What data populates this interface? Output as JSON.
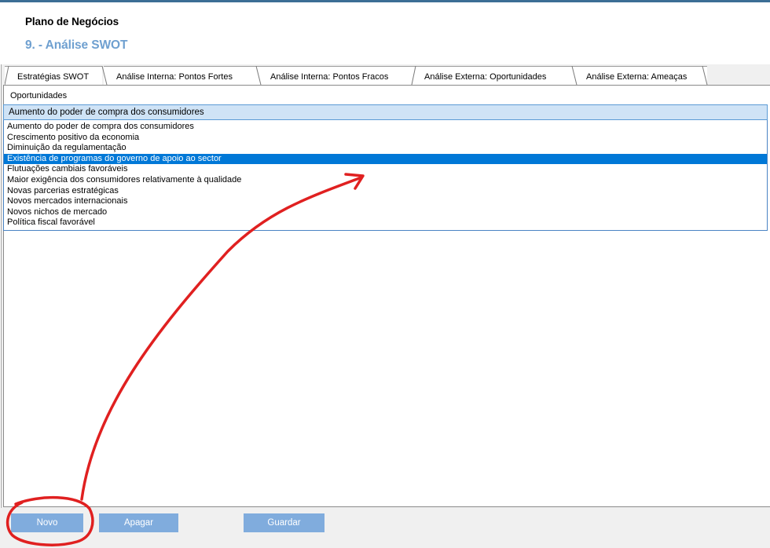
{
  "header": {
    "app_title": "Plano de Negócios",
    "section_title": "9. - Análise SWOT"
  },
  "tabs": [
    {
      "label": "Estratégias SWOT",
      "active": false
    },
    {
      "label": "Análise Interna: Pontos Fortes",
      "active": false
    },
    {
      "label": "Análise Interna: Pontos Fracos",
      "active": false
    },
    {
      "label": "Análise Externa: Oportunidades",
      "active": true
    },
    {
      "label": "Análise Externa: Ameaças",
      "active": false
    }
  ],
  "group": {
    "label": "Oportunidades",
    "selected_value": "Aumento do poder de compra dos consumidores",
    "options": [
      "Aumento do poder de compra dos consumidores",
      "Crescimento positivo da economia",
      "Diminuição da regulamentação",
      "Existência de programas do governo de apoio ao sector",
      "Flutuações cambiais favoráveis",
      "Maior exigência dos consumidores relativamente à qualidade",
      "Novas parcerias estratégicas",
      "Novos mercados internacionais",
      "Novos nichos de mercado",
      "Política fiscal favorável"
    ],
    "highlighted_index": 3
  },
  "buttons": {
    "new_label": "Novo",
    "delete_label": "Apagar",
    "save_label": "Guardar"
  },
  "colors": {
    "accent": "#6fa0d0",
    "selection": "#0078d7",
    "button": "#80acdd",
    "annotation": "#e02020"
  }
}
